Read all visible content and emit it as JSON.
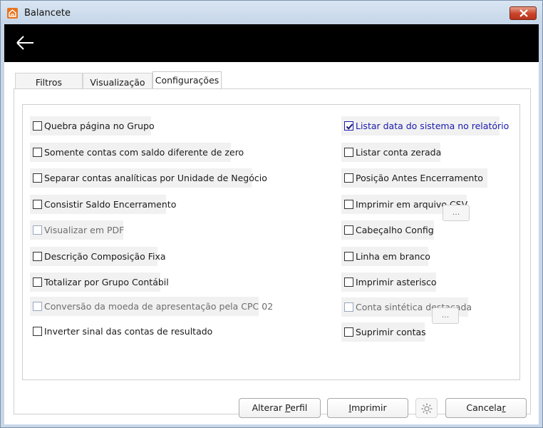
{
  "window": {
    "title": "Balancete"
  },
  "tabs": [
    {
      "label": "Filtros"
    },
    {
      "label": "Visualização"
    },
    {
      "label": "Configurações"
    }
  ],
  "left_options": [
    {
      "label": "Quebra página no Grupo",
      "checked": false,
      "enabled": true
    },
    {
      "label": "Somente contas com saldo diferente de zero",
      "checked": false,
      "enabled": true
    },
    {
      "label": "Separar contas analíticas por Unidade de Negócio",
      "checked": false,
      "enabled": true
    },
    {
      "label": "Consistir Saldo Encerramento",
      "checked": false,
      "enabled": true
    },
    {
      "label": "Visualizar em PDF",
      "checked": false,
      "enabled": false
    },
    {
      "label": "Descrição Composição Fixa",
      "checked": false,
      "enabled": true
    },
    {
      "label": "Totalizar por Grupo Contábil",
      "checked": false,
      "enabled": true
    },
    {
      "label": "Conversão da moeda de apresentação pela CPC 02",
      "checked": false,
      "enabled": false
    },
    {
      "label": "Inverter sinal das contas de resultado",
      "checked": false,
      "enabled": true
    }
  ],
  "right_options": [
    {
      "label": "Listar data do sistema no relatório",
      "checked": true,
      "enabled": true
    },
    {
      "label": "Listar conta zerada",
      "checked": false,
      "enabled": true
    },
    {
      "label": "Posição Antes Encerramento",
      "checked": false,
      "enabled": true
    },
    {
      "label": "Imprimir em arquivo CSV",
      "checked": false,
      "enabled": true
    },
    {
      "label": "Cabeçalho Config",
      "checked": false,
      "enabled": true
    },
    {
      "label": "Linha em branco",
      "checked": false,
      "enabled": true
    },
    {
      "label": "Imprimir asterisco",
      "checked": false,
      "enabled": true
    },
    {
      "label": "Conta sintética destacada",
      "checked": false,
      "enabled": false
    },
    {
      "label": "Suprimir contas",
      "checked": false,
      "enabled": true
    }
  ],
  "dots_button_label": "...",
  "footer": {
    "alterar_perfil_pre": "Alterar ",
    "alterar_perfil_key": "P",
    "alterar_perfil_post": "erfil",
    "imprimir_key": "I",
    "imprimir_post": "mprimir",
    "cancelar_pre": "Cancela",
    "cancelar_key": "r"
  },
  "colors": {
    "header": "#000000",
    "checked_text": "#1a1ab0",
    "close_button": "#c9432a"
  }
}
